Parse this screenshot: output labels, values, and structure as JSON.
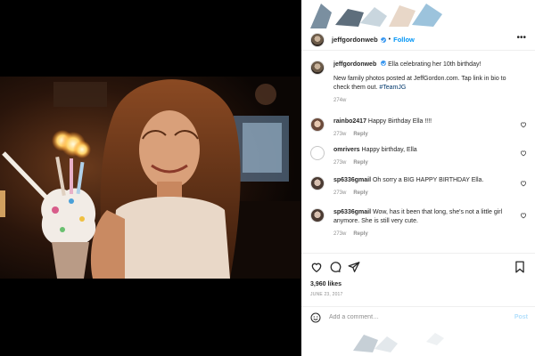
{
  "post": {
    "username": "jeffgordonweb",
    "separator": "•",
    "follow_label": "Follow",
    "more_label": "•••",
    "caption": {
      "username": "jeffgordonweb",
      "text": "Ella celebrating her 10th birthday!",
      "extra": "New family photos posted at JeffGordon.com. Tap link in bio to check them out. ",
      "hashtag": "#TeamJG",
      "age": "274w"
    },
    "comments": [
      {
        "username": "rainbo2417",
        "text": "Happy Birthday Ella !!!!",
        "age": "273w",
        "reply": "Reply"
      },
      {
        "username": "omrivers",
        "text": "Happy birthday, Ella",
        "age": "273w",
        "reply": "Reply"
      },
      {
        "username": "sp6336gmail",
        "text": "Oh sorry a BIG HAPPY BIRTHDAY Ella.",
        "age": "273w",
        "reply": "Reply"
      },
      {
        "username": "sp6336gmail",
        "text": "Wow, has it been that long, she's not a little girl anymore. She is still very cute.",
        "age": "273w",
        "reply": "Reply"
      }
    ],
    "likes": "3,960 likes",
    "date": "JUNE 23, 2017",
    "comment_placeholder": "Add a comment…",
    "post_label": "Post"
  },
  "icons": {
    "heart": "heart-icon",
    "comment": "comment-icon",
    "share": "share-icon",
    "bookmark": "bookmark-icon",
    "emoji": "emoji-icon",
    "verified": "verified-badge-icon"
  },
  "colors": {
    "link_blue": "#0095f6",
    "text": "#262626",
    "muted": "#8e8e8e"
  }
}
